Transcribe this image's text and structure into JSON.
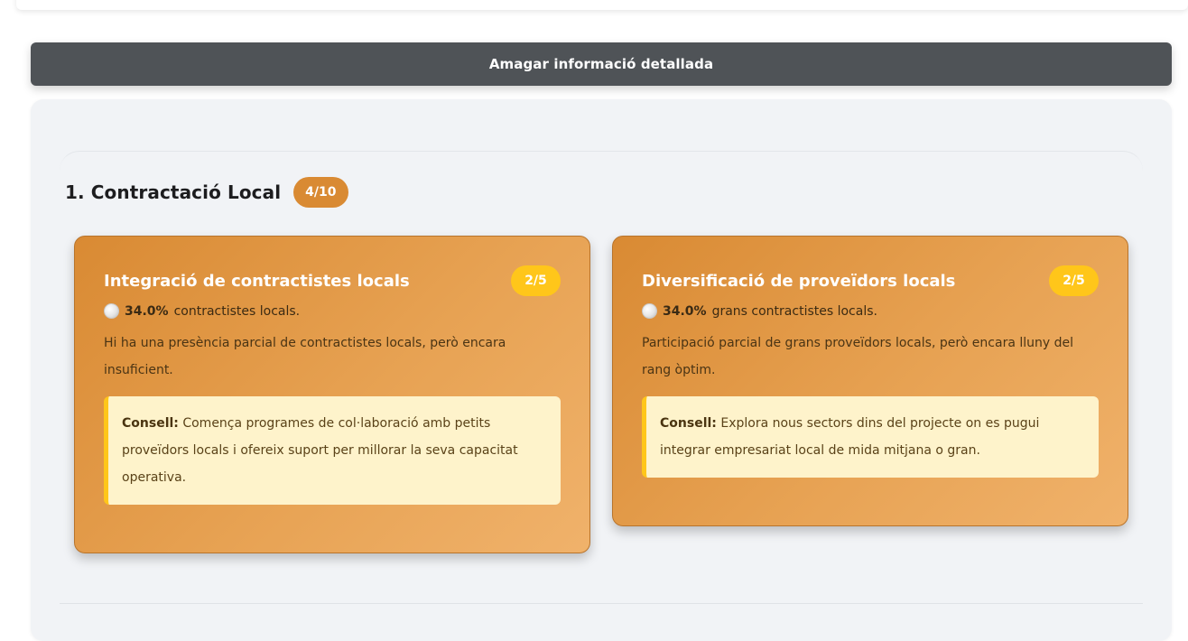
{
  "toggle_button": {
    "label": "Amagar informació detallada"
  },
  "section": {
    "title": "1. Contractació Local",
    "score": "4/10"
  },
  "cards": [
    {
      "title": "Integració de contractistes locals",
      "score": "2/5",
      "stat_value": "34.0%",
      "stat_text": "contractistes locals.",
      "description": "Hi ha una presència parcial de contractistes locals, però encara insuficient.",
      "tip_label": "Consell:",
      "tip_text": "Comença programes de col·laboració amb petits proveïdors locals i ofereix suport per millorar la seva capacitat operativa."
    },
    {
      "title": "Diversificació de proveïdors locals",
      "score": "2/5",
      "stat_value": "34.0%",
      "stat_text": "grans contractistes locals.",
      "description": "Participació parcial de grans proveïdors locals, però encara lluny del rang òptim.",
      "tip_label": "Consell:",
      "tip_text": "Explora nous sectors dins del projecte on es pugui integrar empresariat local de mida mitjana o gran."
    }
  ],
  "colors": {
    "accent_orange": "#d98a33",
    "badge_yellow": "#ffc61a",
    "button_dark": "#4f5357",
    "tip_background": "#fef3cb"
  }
}
